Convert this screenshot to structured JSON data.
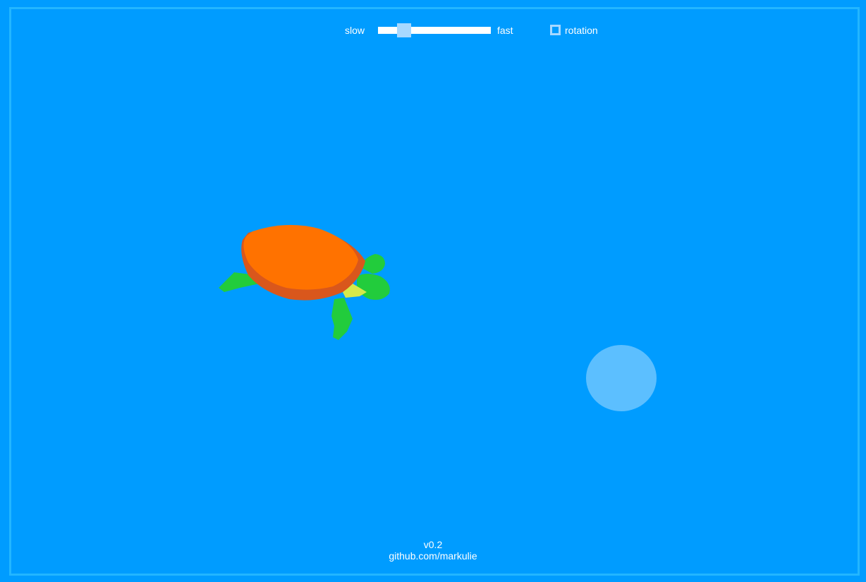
{
  "controls": {
    "speed_slider": {
      "min_label": "slow",
      "max_label": "fast",
      "value_fraction": 0.23
    },
    "rotation": {
      "label": "rotation",
      "checked": false
    }
  },
  "scene": {
    "turtle": {
      "shell_color": "#ff7200",
      "shell_rim_color": "#d9571c",
      "limb_color": "#22cc3c",
      "belly_color": "#d6e94a"
    },
    "bubble": {
      "color": "#5cbfff"
    },
    "water_color": "#009cff"
  },
  "footer": {
    "version": "v0.2",
    "link": "github.com/markulie"
  }
}
